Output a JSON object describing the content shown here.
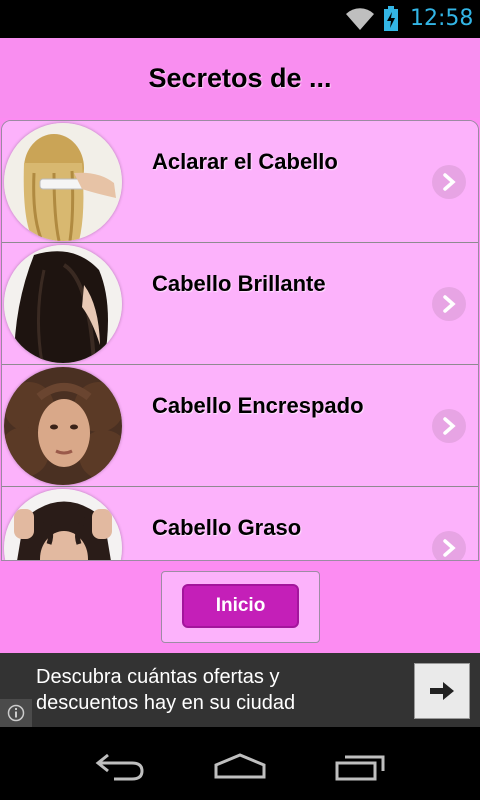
{
  "status_bar": {
    "time": "12:58"
  },
  "title_bar": {
    "title": "Secretos de ..."
  },
  "list": {
    "items": [
      {
        "label": "Aclarar el Cabello"
      },
      {
        "label": "Cabello Brillante"
      },
      {
        "label": "Cabello Encrespado"
      },
      {
        "label": "Cabello Graso"
      }
    ]
  },
  "inicio_button": {
    "label": "Inicio"
  },
  "ad": {
    "text_line1": "Descubra cuántas ofertas y",
    "text_line2": "descuentos hay en su ciudad"
  },
  "colors": {
    "header": "#f98ef0",
    "list_bg": "#fcb2fb",
    "button": "#c41fb8",
    "clock": "#33b5e5"
  }
}
